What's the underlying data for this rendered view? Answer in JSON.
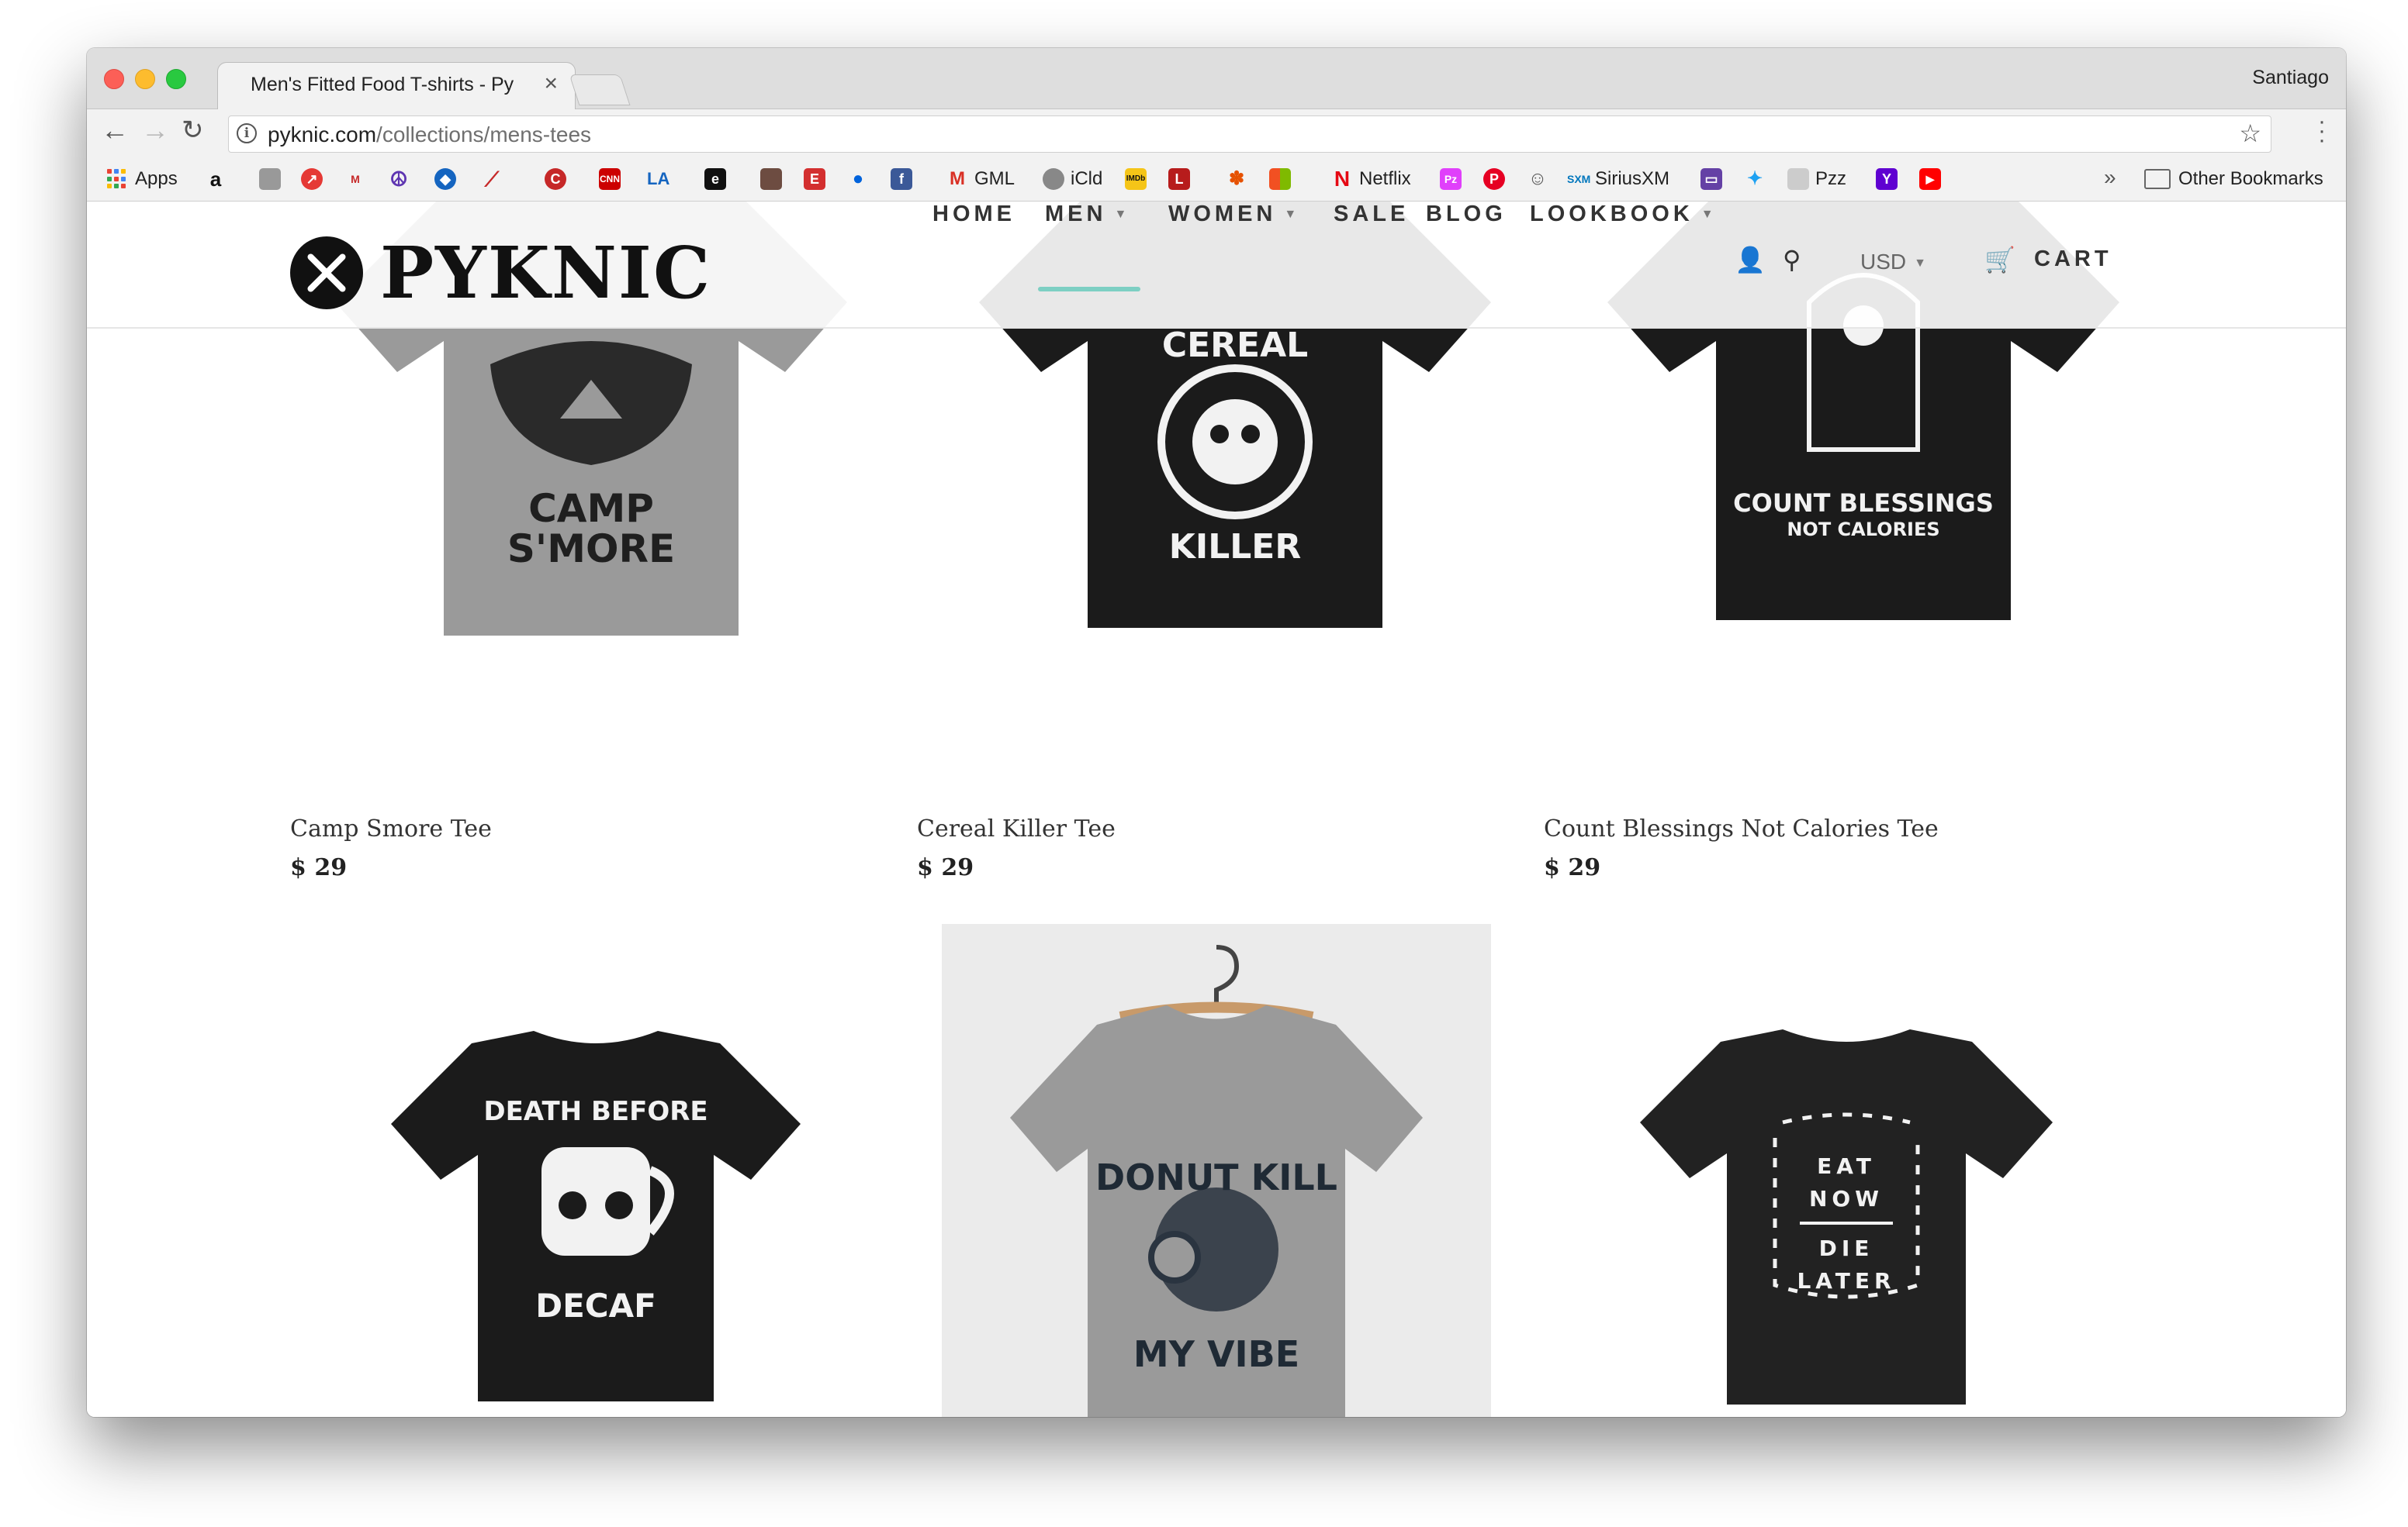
{
  "browser": {
    "tab_title": "Men's Fitted Food T-shirts - Py",
    "profile_name": "Santiago",
    "url_host": "pyknic.com",
    "url_path": "/collections/mens-tees",
    "bookmarks": {
      "apps": "Apps",
      "gml": "GML",
      "icld": "iCld",
      "netflix": "Netflix",
      "siriusxm": "SiriusXM",
      "pzz": "Pzz",
      "other": "Other Bookmarks"
    }
  },
  "store": {
    "logo_text": "PYKNIC",
    "nav": {
      "home": "HOME",
      "men": "MEN",
      "women": "WOMEN",
      "sale": "SALE",
      "blog": "BLOG",
      "lookbook": "LOOKBOOK",
      "currency": "USD",
      "cart": "CART"
    },
    "active_nav": "MEN",
    "accent_color": "#7dcfc3"
  },
  "products": [
    {
      "title": "Camp Smore Tee",
      "price": "$ 29",
      "shirt_color": "#9a9a9a",
      "graphic_lines": [
        "CAMP",
        "S'MORE"
      ]
    },
    {
      "title": "Cereal Killer Tee",
      "price": "$ 29",
      "shirt_color": "#1b1b1b",
      "graphic_lines": [
        "CEREAL",
        "KILLER"
      ]
    },
    {
      "title": "Count Blessings Not Calories Tee",
      "price": "$ 29",
      "shirt_color": "#1b1b1b",
      "graphic_lines": [
        "COUNT BLESSINGS",
        "NOT CALORIES"
      ]
    },
    {
      "shirt_color": "#1b1b1b",
      "graphic_lines": [
        "DEATH BEFORE",
        "DECAF"
      ]
    },
    {
      "shirt_color": "#9a9a9a",
      "graphic_lines": [
        "DONUT KILL",
        "MY VIBE"
      ]
    },
    {
      "shirt_color": "#222222",
      "graphic_lines": [
        "EAT",
        "NOW",
        "DIE",
        "LATER"
      ]
    }
  ]
}
